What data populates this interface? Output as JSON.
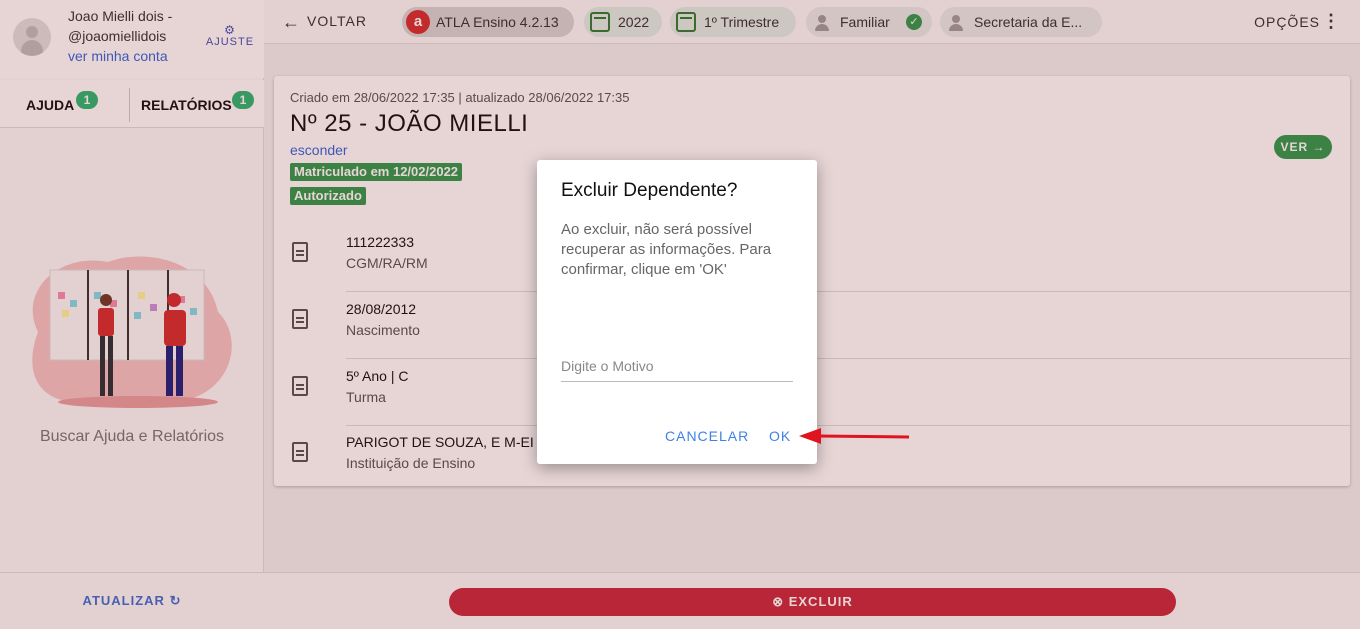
{
  "user": {
    "name": "Joao Mielli dois - @joaomiellidois",
    "account_link": "ver minha conta",
    "ajuste_label": "AJUSTE"
  },
  "sidebar": {
    "tabs": [
      {
        "label": "AJUDA",
        "badge": "1"
      },
      {
        "label": "RELATÓRIOS",
        "badge": "1"
      }
    ],
    "help_text": "Buscar Ajuda e Relatórios",
    "footer_label": "ATUALIZAR"
  },
  "topbar": {
    "back_label": "VOLTAR",
    "chips": {
      "app": "ATLA Ensino 4.2.13",
      "year": "2022",
      "period": "1º Trimestre",
      "role": "Familiar",
      "org": "Secretaria da E..."
    },
    "options_label": "OPÇÕES"
  },
  "card": {
    "created": "Criado em 28/06/2022 17:35 | atualizado 28/06/2022 17:35",
    "title": "Nº 25 - JOÃO MIELLI",
    "hide_link": "esconder",
    "tags": [
      "Matriculado em 12/02/2022",
      "Autorizado"
    ],
    "view_button": "VER",
    "rows": [
      {
        "value": "111222333",
        "label": "CGM/RA/RM"
      },
      {
        "value": "28/08/2012",
        "label": "Nascimento"
      },
      {
        "value": "5º Ano | C",
        "label": "Turma"
      },
      {
        "value": "PARIGOT DE SOUZA, E M-EI",
        "label": "Instituição de Ensino"
      }
    ]
  },
  "bottom": {
    "delete_label": "EXCLUIR"
  },
  "dialog": {
    "title": "Excluir Dependente?",
    "message": "Ao excluir, não será possível recuperar as informações. Para confirmar, clique em 'OK'",
    "input_placeholder": "Digite o Motivo",
    "input_value": "",
    "cancel_label": "CANCELAR",
    "ok_label": "OK"
  },
  "colors": {
    "accent_green": "#2e9a4e",
    "danger_red": "#c62a3e",
    "link_blue": "#3f81e5",
    "annotation_red": "#e0141e"
  }
}
